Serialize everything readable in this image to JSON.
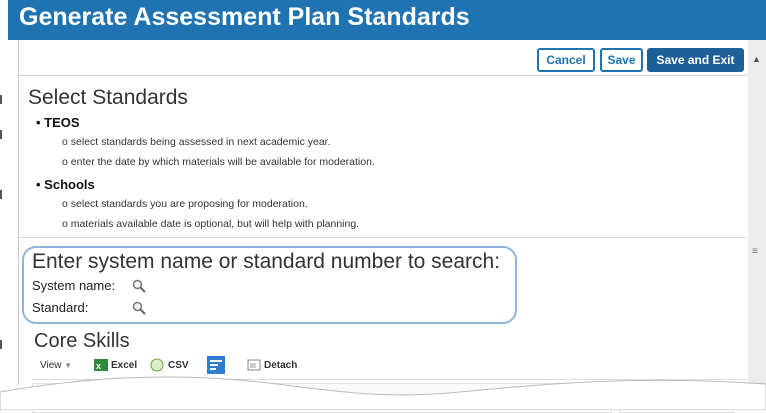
{
  "title": "Generate Assessment Plan Standards",
  "buttons": {
    "cancel": "Cancel",
    "save": "Save",
    "save_exit": "Save and Exit"
  },
  "select_standards": {
    "heading": "Select Standards",
    "groups": [
      {
        "label": "TEOS",
        "items": [
          "select standards being assessed in next academic year.",
          "enter the date by which materials will be available for moderation."
        ]
      },
      {
        "label": "Schools",
        "items": [
          "select standards you are proposing for moderation.",
          "materials available date is optional, but will help with planning."
        ]
      }
    ]
  },
  "search": {
    "heading": "Enter system name or standard number to search:",
    "system_name_label": "System name:",
    "standard_label": "Standard:"
  },
  "core_skills": {
    "heading": "Core Skills",
    "toolbar": {
      "view": "View",
      "excel": "Excel",
      "csv": "CSV",
      "detach": "Detach"
    }
  },
  "icons": {
    "search": "magnifier-icon",
    "excel": "excel-icon",
    "csv": "csv-icon",
    "freeze": "freeze-columns-icon",
    "detach": "detach-icon"
  },
  "colors": {
    "title_bar": "#1f73b0",
    "primary_button": "#1f5f99",
    "search_highlight": "#8fb4d8"
  }
}
